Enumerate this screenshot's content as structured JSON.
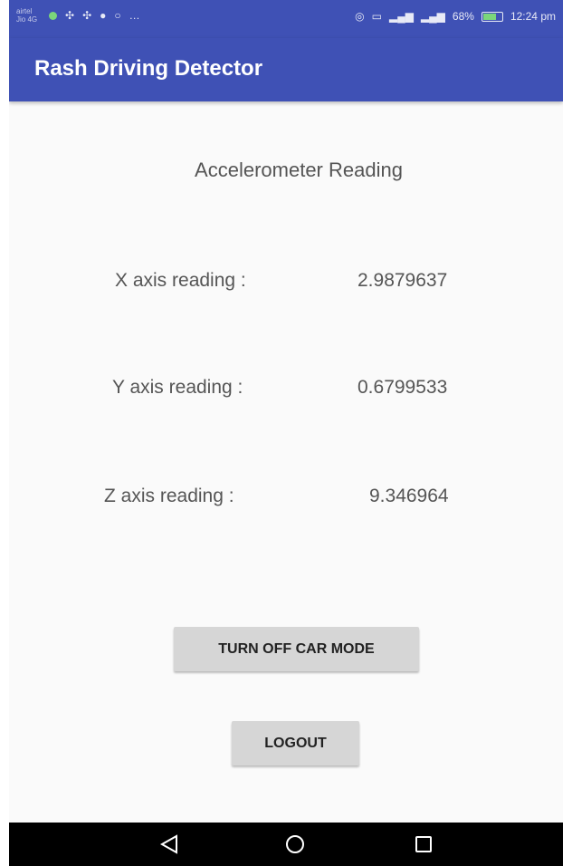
{
  "status_bar": {
    "carrier_line1": "airtel",
    "carrier_line2": "Jio 4G",
    "indicators": "«»",
    "battery": "68%",
    "time": "12:24 pm",
    "more": "…"
  },
  "toolbar": {
    "title": "Rash Driving Detector",
    "color": "#3f51b5"
  },
  "main": {
    "heading": "Accelerometer Reading",
    "readings": [
      {
        "label": "X axis reading :",
        "value": "2.9879637"
      },
      {
        "label": "Y axis reading :",
        "value": "0.6799533"
      },
      {
        "label": "Z axis reading :",
        "value": "9.346964"
      }
    ],
    "car_mode_button": "TURN OFF CAR MODE",
    "logout_button": "LOGOUT"
  },
  "nav_bar": {
    "back_icon": "back-triangle-icon",
    "home_icon": "home-circle-icon",
    "recent_icon": "recent-apps-square-icon"
  }
}
